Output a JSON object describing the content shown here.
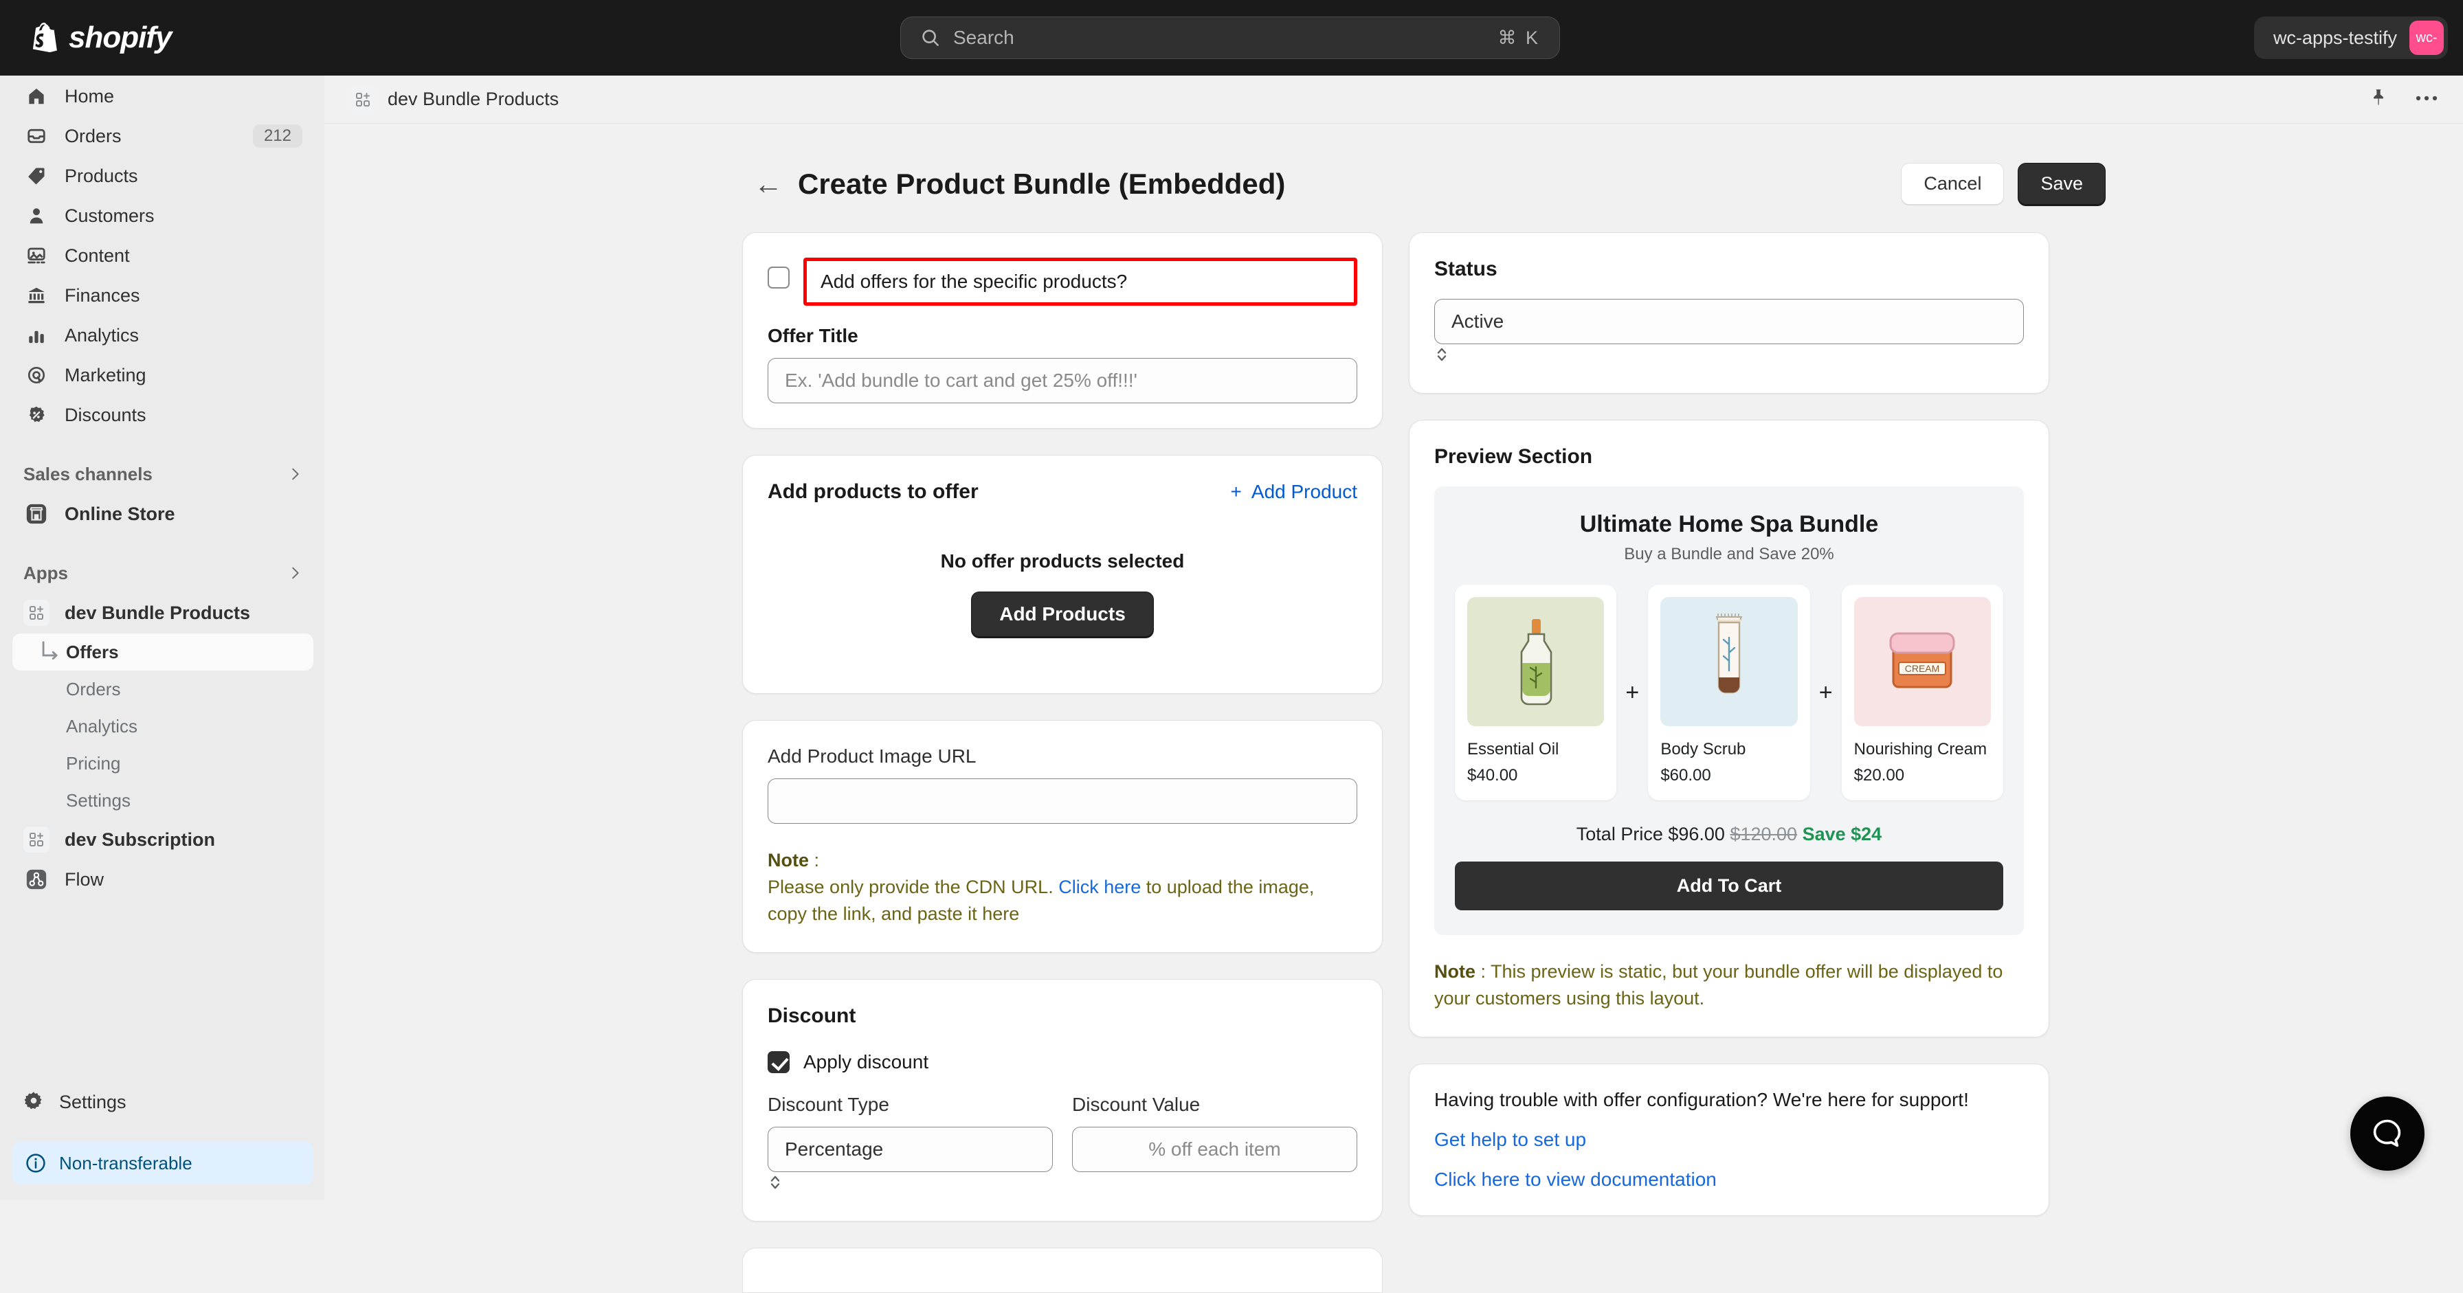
{
  "topbar": {
    "logo_text": "shopify",
    "search_placeholder": "Search",
    "search_shortcut": "⌘ K",
    "store_name": "wc-apps-testify",
    "store_initials": "wc-"
  },
  "sidebar": {
    "items": [
      {
        "label": "Home",
        "icon": "home-icon",
        "badge": ""
      },
      {
        "label": "Orders",
        "icon": "orders-icon",
        "badge": "212"
      },
      {
        "label": "Products",
        "icon": "products-tag-icon",
        "badge": ""
      },
      {
        "label": "Customers",
        "icon": "customers-person-icon",
        "badge": ""
      },
      {
        "label": "Content",
        "icon": "content-image-icon",
        "badge": ""
      },
      {
        "label": "Finances",
        "icon": "finances-bank-icon",
        "badge": ""
      },
      {
        "label": "Analytics",
        "icon": "analytics-bars-icon",
        "badge": ""
      },
      {
        "label": "Marketing",
        "icon": "marketing-target-icon",
        "badge": ""
      },
      {
        "label": "Discounts",
        "icon": "discounts-badge-icon",
        "badge": ""
      }
    ],
    "sales_channels_label": "Sales channels",
    "online_store_label": "Online Store",
    "apps_label": "Apps",
    "app_bundle_label": "dev Bundle Products",
    "app_sub_items": [
      {
        "label": "Offers",
        "active": true
      },
      {
        "label": "Orders",
        "active": false
      },
      {
        "label": "Analytics",
        "active": false
      },
      {
        "label": "Pricing",
        "active": false
      },
      {
        "label": "Settings",
        "active": false
      }
    ],
    "app_subscription_label": "dev Subscription",
    "flow_label": "Flow",
    "settings_label": "Settings",
    "non_transferable_label": "Non-transferable"
  },
  "app_header": {
    "breadcrumb": "dev Bundle Products",
    "pin_icon": "pin-icon",
    "more_icon": "more-horizontal-icon"
  },
  "page": {
    "title": "Create Product Bundle (Embedded)",
    "back_icon": "arrow-left-icon",
    "cancel_label": "Cancel",
    "save_label": "Save"
  },
  "offer_card": {
    "checkbox_label": "Add offers for the specific products?",
    "checkbox_checked": false,
    "highlight_color": "#ff0000",
    "offer_title_label": "Offer Title",
    "offer_title_value": "",
    "offer_title_placeholder": "Ex. 'Add bundle to cart and get 25% off!!!'"
  },
  "products_card": {
    "title": "Add products to offer",
    "add_product_link": "Add Product",
    "add_product_plus": "+",
    "empty_message": "No offer products selected",
    "add_products_button": "Add Products"
  },
  "image_url_card": {
    "label": "Add Product Image URL",
    "value": "",
    "placeholder": "",
    "note_label": "Note",
    "note_colon": " :",
    "note_text_1": "Please only provide the CDN URL. ",
    "note_link": "Click here",
    "note_text_2": " to upload the image, copy the link, and paste it here"
  },
  "discount_card": {
    "title": "Discount",
    "apply_discount_label": "Apply discount",
    "apply_discount_checked": true,
    "discount_type_label": "Discount Type",
    "discount_type_value": "Percentage",
    "discount_value_label": "Discount Value",
    "discount_value": "",
    "discount_value_placeholder": "% off each item"
  },
  "status_card": {
    "title": "Status",
    "value": "Active"
  },
  "preview_card": {
    "title": "Preview Section",
    "bundle_title": "Ultimate Home Spa Bundle",
    "bundle_subtitle": "Buy a Bundle and Save 20%",
    "plus_symbol": "+",
    "products": [
      {
        "name": "Essential Oil",
        "price": "$40.00",
        "bg": "#e2e8cf",
        "icon": "oil-bottle-icon"
      },
      {
        "name": "Body Scrub",
        "price": "$60.00",
        "bg": "#e0eef3",
        "icon": "scrub-tube-icon"
      },
      {
        "name": "Nourishing Cream",
        "price": "$20.00",
        "bg": "#f8e4e4",
        "icon": "cream-jar-icon"
      }
    ],
    "total_label": "Total Price",
    "total_price": "$96.00",
    "original_price": "$120.00",
    "save_text": "Save $24",
    "add_to_cart_label": "Add To Cart",
    "note_label": "Note",
    "note_text": " : This preview is static, but your bundle offer will be displayed to your customers using this layout."
  },
  "support_card": {
    "headline": "Having trouble with offer configuration? We're here for support!",
    "link_1": "Get help to set up",
    "link_2": "Click here to view documentation"
  },
  "chat": {
    "icon": "chat-bubble-icon"
  }
}
